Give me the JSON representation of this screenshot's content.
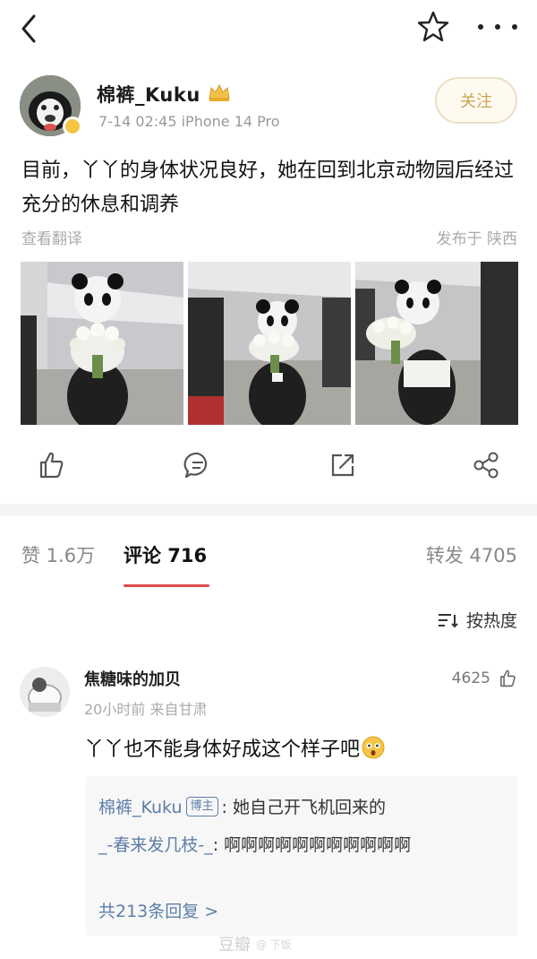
{
  "post": {
    "author": "棉裤_Kuku",
    "meta": "7-14 02:45  iPhone 14 Pro",
    "follow_label": "关注",
    "text": "目前，丫丫的身体状况良好，她在回到北京动物园后经过充分的休息和调养",
    "translate_label": "查看翻译",
    "location": "发布于 陕西"
  },
  "tabs": {
    "likes": "赞 1.6万",
    "comments": "评论 716",
    "reposts": "转发 4705"
  },
  "sort_label": "按热度",
  "comment": {
    "name": "焦糖味的加贝",
    "meta": "20小时前  来自甘肃",
    "likes": "4625",
    "text": "丫丫也不能身体好成这个样子吧",
    "replies": [
      {
        "name": "棉裤_Kuku",
        "tag": "博主",
        "text": ": 她自己开飞机回来的"
      },
      {
        "name": "_-春来发几枝-_",
        "text": ": 啊啊啊啊啊啊啊啊啊啊啊"
      }
    ],
    "total_replies": "共213条回复 >"
  },
  "watermark": {
    "main": "豆瓣",
    "sub": "@ 下饭"
  },
  "colors": {
    "accent_red": "#e24b4b",
    "link_blue": "#5d7ea8",
    "follow_gold": "#c9a45a"
  },
  "icons": [
    "back-icon",
    "star-icon",
    "more-icon",
    "crown-icon",
    "like-icon",
    "comment-icon",
    "repost-icon",
    "share-icon",
    "sort-icon",
    "emoji-icon"
  ]
}
